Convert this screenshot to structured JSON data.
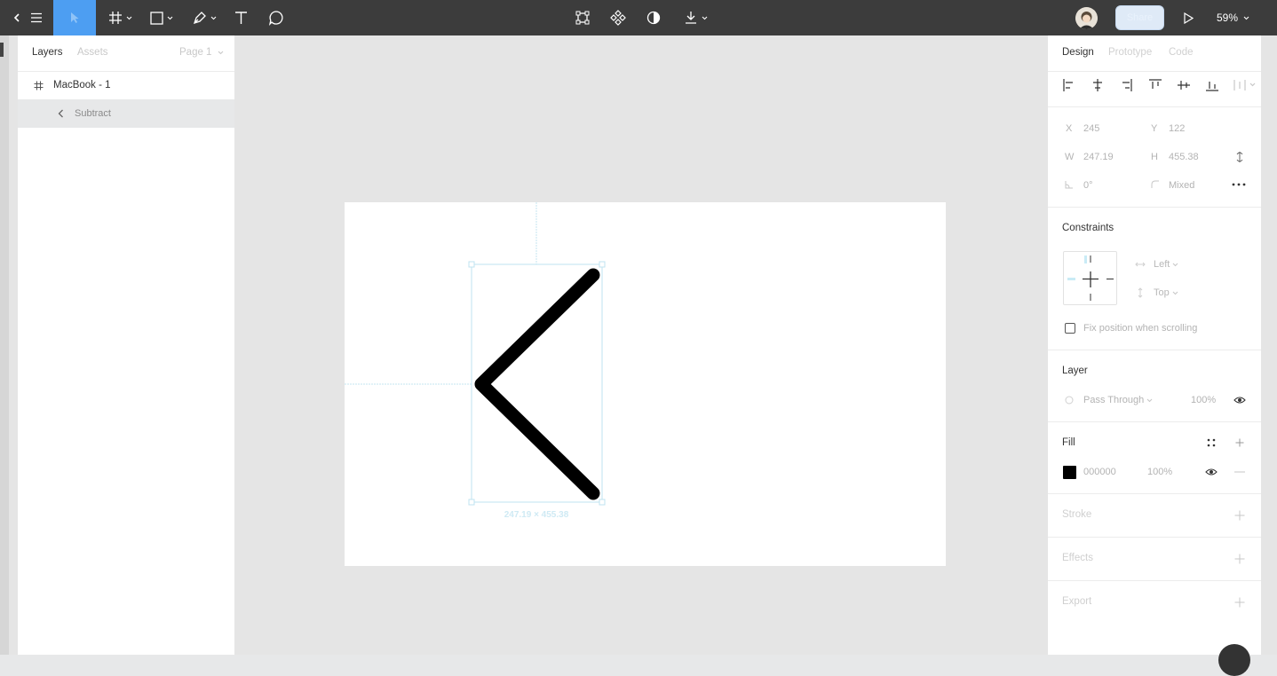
{
  "toolbar": {
    "zoom": "59%",
    "share_label": "Share",
    "tools": [
      "menu",
      "move",
      "frame",
      "shape",
      "pen",
      "text",
      "comment"
    ],
    "center_tools": [
      "component",
      "component-set",
      "mask",
      "boolean"
    ]
  },
  "left_panel": {
    "tabs": {
      "layers": "Layers",
      "assets": "Assets"
    },
    "page_selector": "Page 1",
    "layers": [
      {
        "label": "MacBook - 1",
        "icon": "frame-hash-icon"
      },
      {
        "label": "Subtract",
        "icon": "chevron-left-icon"
      }
    ]
  },
  "canvas": {
    "selection_size": "247.19 × 455.38",
    "stroke_color": "#000000",
    "selection_color": "#bfe3f0"
  },
  "right_panel": {
    "tabs": {
      "design": "Design",
      "prototype": "Prototype",
      "code": "Code"
    },
    "position": {
      "x_label": "X",
      "x": "245",
      "y_label": "Y",
      "y": "122"
    },
    "size": {
      "w_label": "W",
      "w": "247.19",
      "h_label": "H",
      "h": "455.38"
    },
    "rotation": "0°",
    "radius": "Mixed",
    "constraints": {
      "title": "Constraints",
      "horizontal": "Left",
      "vertical": "Top",
      "fix_label": "Fix position when scrolling"
    },
    "layer": {
      "title": "Layer",
      "blend": "Pass Through",
      "opacity": "100%"
    },
    "fill": {
      "title": "Fill",
      "hex": "000000",
      "opacity": "100%",
      "color": "#000000"
    },
    "stroke": {
      "title": "Stroke"
    },
    "effects": {
      "title": "Effects"
    },
    "export": {
      "title": "Export"
    }
  }
}
